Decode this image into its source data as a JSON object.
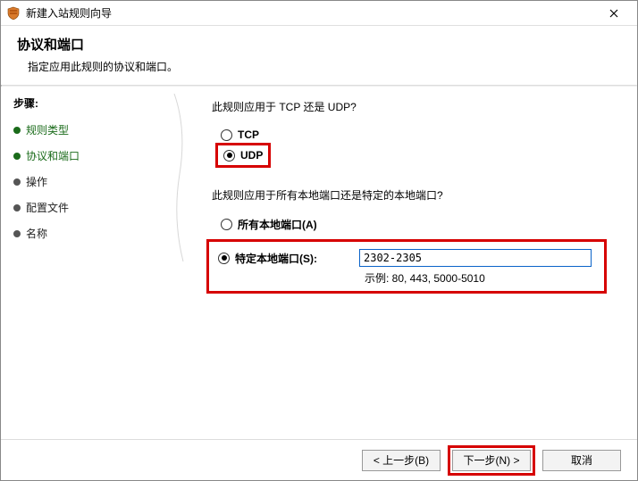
{
  "window": {
    "title": "新建入站规则向导"
  },
  "header": {
    "title": "协议和端口",
    "description": "指定应用此规则的协议和端口。"
  },
  "steps": {
    "heading": "步骤:",
    "items": [
      {
        "label": "规则类型",
        "state": "completed"
      },
      {
        "label": "协议和端口",
        "state": "current"
      },
      {
        "label": "操作",
        "state": "pending"
      },
      {
        "label": "配置文件",
        "state": "pending"
      },
      {
        "label": "名称",
        "state": "pending"
      }
    ]
  },
  "content": {
    "protocol_question": "此规则应用于 TCP 还是 UDP?",
    "protocol_options": {
      "tcp": "TCP",
      "udp": "UDP"
    },
    "protocol_selected": "udp",
    "port_question": "此规则应用于所有本地端口还是特定的本地端口?",
    "port_options": {
      "all": "所有本地端口(A)",
      "specific": "特定本地端口(S):"
    },
    "port_selected": "specific",
    "port_value": "2302-2305",
    "port_example": "示例: 80, 443, 5000-5010"
  },
  "footer": {
    "back": "< 上一步(B)",
    "next": "下一步(N) >",
    "cancel": "取消"
  }
}
